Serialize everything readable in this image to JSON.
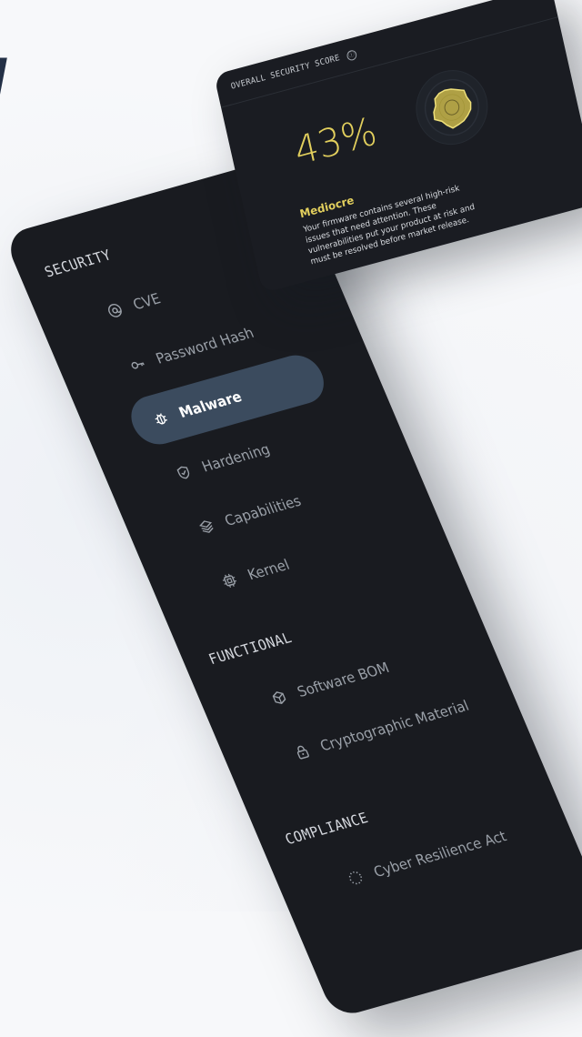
{
  "backdrop": {
    "fragment": "l"
  },
  "sidebar": {
    "sections": [
      {
        "title": "SECURITY",
        "items": [
          {
            "label": "CVE",
            "icon": "at-icon",
            "active": false
          },
          {
            "label": "Password Hash",
            "icon": "key-icon",
            "active": false
          },
          {
            "label": "Malware",
            "icon": "bug-icon",
            "active": true
          },
          {
            "label": "Hardening",
            "icon": "shield-icon",
            "active": false
          },
          {
            "label": "Capabilities",
            "icon": "layers-icon",
            "active": false
          },
          {
            "label": "Kernel",
            "icon": "chip-icon",
            "active": false
          }
        ]
      },
      {
        "title": "FUNCTIONAL",
        "items": [
          {
            "label": "Software BOM",
            "icon": "cube-icon",
            "active": false
          },
          {
            "label": "Cryptographic Material",
            "icon": "lock-icon",
            "active": false
          }
        ]
      },
      {
        "title": "COMPLIANCE",
        "items": [
          {
            "label": "Cyber Resilience Act",
            "icon": "circle-dotted-icon",
            "active": false
          }
        ]
      }
    ]
  },
  "score_card": {
    "title": "OVERALL SECURITY SCORE",
    "info_icon": "ⓘ",
    "score": "43%",
    "score_value": 43,
    "rating": "Mediocre",
    "description": "Your firmware contains several high-risk issues that need attention. These vulnerabilities put your product at risk and must be resolved before market release."
  },
  "colors": {
    "panel_bg": "#191b20",
    "active_bg": "#3b4b5e",
    "accent_yellow": "#e2cf5d",
    "text_muted": "#9aa0a8"
  }
}
